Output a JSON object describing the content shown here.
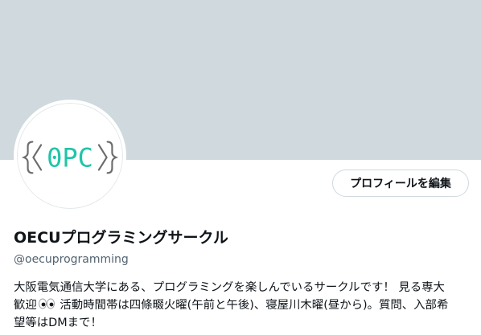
{
  "profile": {
    "edit_button_label": "プロフィールを編集",
    "display_name": "OECUプログラミングサークル",
    "handle": "@oecuprogramming",
    "bio_line1": "大阪電気通信大学にある、プログラミングを楽しんでいるサークルです！ 見る専大",
    "bio_line2_a": "歓迎",
    "bio_line2_b": "活動時間帯は四條畷火曜(午前と午後)、寝屋川木曜(昼から)。質問、入部希",
    "bio_line3": "望等はDMまで！"
  },
  "avatar": {
    "logo_text": "0PC",
    "icon": "opc-logo"
  },
  "colors": {
    "banner": "#cfd9de",
    "logo_accent": "#1fc5a8",
    "logo_brackets": "#6b6b6b",
    "handle": "#536471",
    "text": "#0f1419"
  }
}
